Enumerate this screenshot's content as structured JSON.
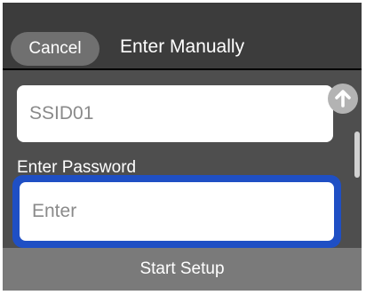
{
  "header": {
    "cancel_label": "Cancel",
    "title": "Enter Manually"
  },
  "form": {
    "ssid_value": "SSID01",
    "password_label": "Enter Password",
    "password_placeholder": "Enter"
  },
  "icons": {
    "scroll_up": "arrow-up-icon"
  },
  "footer": {
    "start_setup_label": "Start Setup"
  },
  "colors": {
    "header_bg": "#3c3c3c",
    "content_bg": "#4e4e4e",
    "focus_border": "#1f4fc4",
    "footer_bg": "#7a7a7a",
    "cancel_bg": "#707070"
  }
}
